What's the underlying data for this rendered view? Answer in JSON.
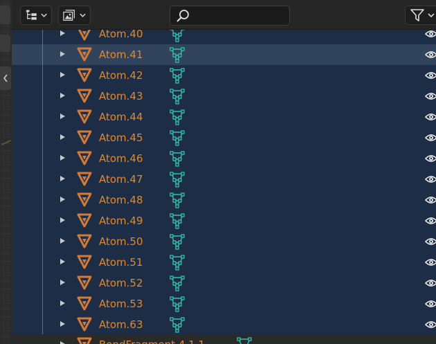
{
  "header": {
    "display_mode_icon": "outliner-tree-icon",
    "filter_type_icon": "image-stack-icon",
    "search": {
      "value": "",
      "placeholder": ""
    },
    "filter_icon": "funnel-icon"
  },
  "colors": {
    "object_name": "#e0892f",
    "object_icon": "#d27a3a",
    "mesh_icon": "#2cc6b3",
    "selected_row": "#32435c",
    "background": "#1d2d45"
  },
  "rows": [
    {
      "name": "Atom.40",
      "selected": false
    },
    {
      "name": "Atom.41",
      "selected": true
    },
    {
      "name": "Atom.42",
      "selected": false
    },
    {
      "name": "Atom.43",
      "selected": false
    },
    {
      "name": "Atom.44",
      "selected": false
    },
    {
      "name": "Atom.45",
      "selected": false
    },
    {
      "name": "Atom.46",
      "selected": false
    },
    {
      "name": "Atom.47",
      "selected": false
    },
    {
      "name": "Atom.48",
      "selected": false
    },
    {
      "name": "Atom.49",
      "selected": false
    },
    {
      "name": "Atom.50",
      "selected": false
    },
    {
      "name": "Atom.51",
      "selected": false
    },
    {
      "name": "Atom.52",
      "selected": false
    },
    {
      "name": "Atom.53",
      "selected": false
    },
    {
      "name": "Atom.63",
      "selected": false
    }
  ],
  "partial_row": {
    "name": "BondFragment.4.1.1"
  }
}
